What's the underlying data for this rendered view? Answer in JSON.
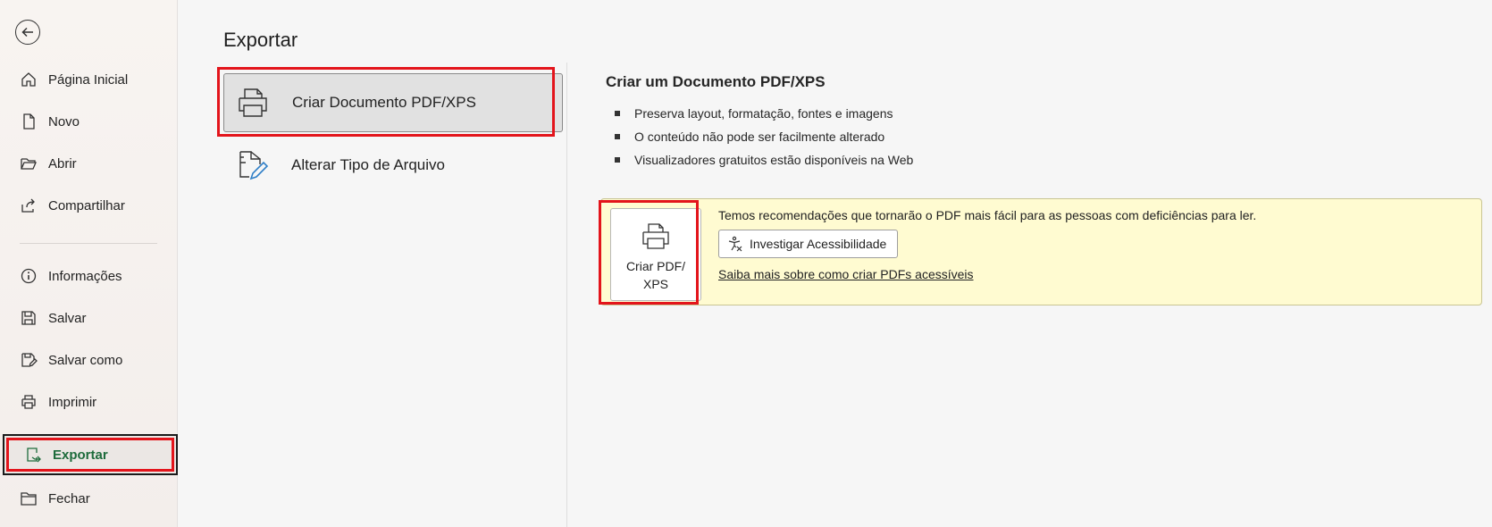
{
  "sidebar": {
    "items": [
      {
        "label": "Página Inicial",
        "icon": "home-icon"
      },
      {
        "label": "Novo",
        "icon": "new-document-icon"
      },
      {
        "label": "Abrir",
        "icon": "open-folder-icon"
      },
      {
        "label": "Compartilhar",
        "icon": "share-icon"
      },
      {
        "label": "Informações",
        "icon": "info-icon"
      },
      {
        "label": "Salvar",
        "icon": "save-icon"
      },
      {
        "label": "Salvar como",
        "icon": "save-as-icon"
      },
      {
        "label": "Imprimir",
        "icon": "print-icon"
      },
      {
        "label": "Exportar",
        "icon": "export-icon",
        "active": true
      },
      {
        "label": "Fechar",
        "icon": "close-folder-icon"
      }
    ],
    "active_color": "#1d6b3b"
  },
  "main": {
    "title": "Exportar",
    "options": [
      {
        "label": "Criar Documento PDF/XPS",
        "icon": "pdf-printer-icon",
        "selected": true
      },
      {
        "label": "Alterar Tipo de Arquivo",
        "icon": "change-file-type-icon"
      }
    ],
    "detail": {
      "heading": "Criar um Documento PDF/XPS",
      "bullets": [
        "Preserva layout, formatação, fontes e imagens",
        "O conteúdo não pode ser facilmente alterado",
        "Visualizadores gratuitos estão disponíveis na Web"
      ],
      "create_button_label": "Criar PDF/ XPS",
      "recommendation": "Temos recomendações que tornarão o PDF mais fácil para as pessoas com deficiências para ler.",
      "accessibility_button": "Investigar Acessibilidade",
      "learn_more_link": "Saiba mais sobre como criar PDFs acessíveis"
    }
  },
  "colors": {
    "highlight_red": "#e3141b",
    "recommendation_bg": "#fffbd1"
  }
}
